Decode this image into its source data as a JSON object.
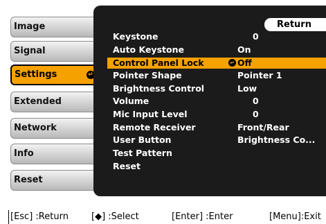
{
  "sidebar": {
    "items": [
      {
        "label": "Image"
      },
      {
        "label": "Signal"
      },
      {
        "label": "Settings",
        "active": true
      },
      {
        "label": "Extended"
      },
      {
        "label": "Network"
      },
      {
        "label": "Info"
      },
      {
        "label": "Reset"
      }
    ]
  },
  "panel": {
    "return_label": "Return",
    "rows": [
      {
        "label": "Keystone",
        "value": "0"
      },
      {
        "label": "Auto Keystone",
        "value": "On"
      },
      {
        "label": "Control Panel Lock",
        "value": "Off",
        "selected": true
      },
      {
        "label": "Pointer Shape",
        "value": "Pointer 1"
      },
      {
        "label": "Brightness Control",
        "value": "Low"
      },
      {
        "label": "Volume",
        "value": "0"
      },
      {
        "label": "Mic Input Level",
        "value": "0"
      },
      {
        "label": "Remote Receiver",
        "value": "Front/Rear"
      },
      {
        "label": "User Button",
        "value": "Brightness Co..."
      },
      {
        "label": "Test Pattern",
        "value": ""
      },
      {
        "label": "Reset",
        "value": ""
      }
    ]
  },
  "footer": {
    "esc": "[Esc] :Return",
    "select": "[◆] :Select",
    "enter": "[Enter] :Enter",
    "menu": "[Menu]:Exit"
  },
  "colors": {
    "accent": "#f5a100",
    "panel_bg": "#1b1b1b"
  }
}
